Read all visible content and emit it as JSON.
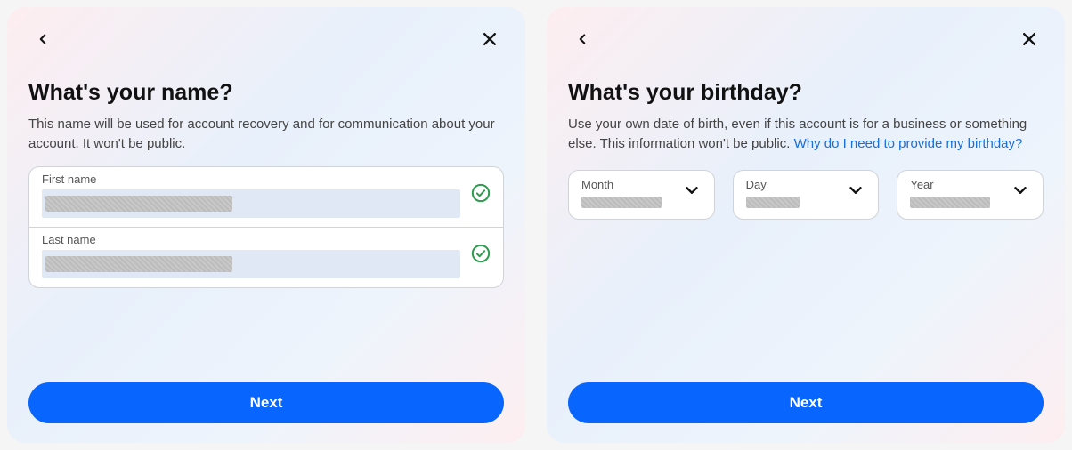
{
  "panel_name": {
    "title": "What's your name?",
    "subtitle": "This name will be used for account recovery and for communication about your account. It won't be public.",
    "first_name_label": "First name",
    "last_name_label": "Last name",
    "next_label": "Next"
  },
  "panel_birthday": {
    "title": "What's your birthday?",
    "subtitle_pre": "Use your own date of birth, even if this account is for a business or something else. This information won't be public. ",
    "subtitle_link": "Why do I need to provide my birthday?",
    "month_label": "Month",
    "day_label": "Day",
    "year_label": "Year",
    "next_label": "Next"
  },
  "colors": {
    "primary": "#0866ff",
    "link": "#1a6ed8",
    "success": "#2e9b4f"
  }
}
